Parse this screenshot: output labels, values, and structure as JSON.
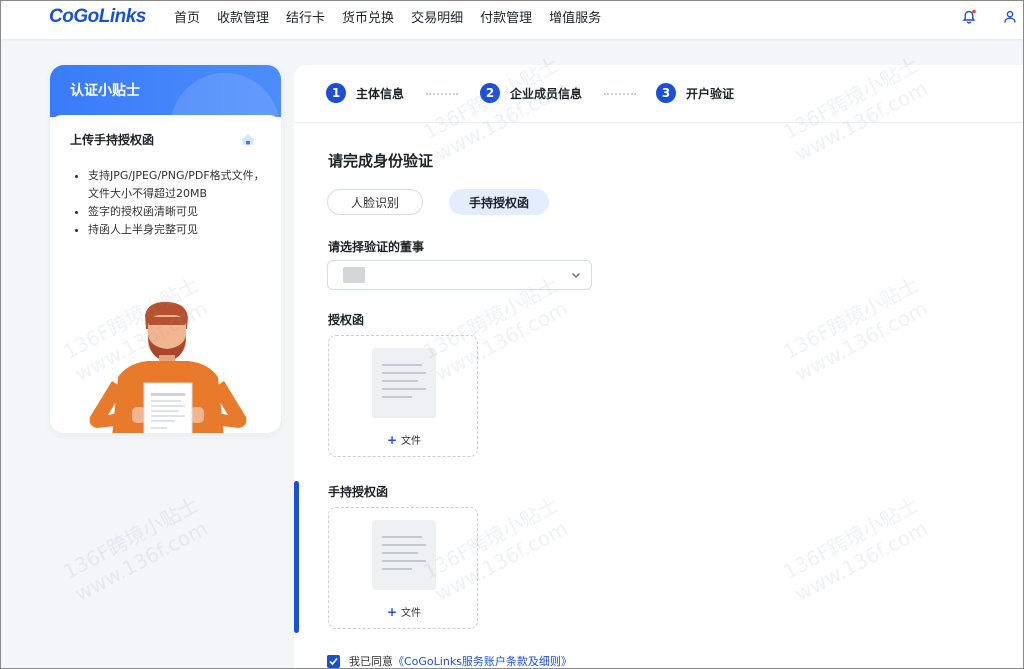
{
  "nav": {
    "logo": "CoGoLinks",
    "items": [
      "首页",
      "收款管理",
      "结行卡",
      "货币兑换",
      "交易明细",
      "付款管理",
      "增值服务"
    ]
  },
  "tip": {
    "title": "认证小贴士",
    "subtitle": "上传手持授权函",
    "items": [
      "支持JPG/JPEG/PNG/PDF格式文件， 文件大小不得超过20MB",
      "签字的授权函清晰可见",
      "持函人上半身完整可见"
    ]
  },
  "steps": [
    {
      "num": "1",
      "label": "主体信息"
    },
    {
      "num": "2",
      "label": "企业成员信息"
    },
    {
      "num": "3",
      "label": "开户验证"
    }
  ],
  "form": {
    "section_title": "请完成身份验证",
    "tabs": {
      "face": "人脸识别",
      "hand": "手持授权函"
    },
    "director_label": "请选择验证的董事",
    "auth_letter_label": "授权函",
    "hand_letter_label": "手持授权函",
    "upload_label": "文件",
    "agree_text": "我已同意",
    "agree_link": "《CoGoLinks服务账户条款及细则》"
  },
  "watermark": {
    "line1": "136F跨境小贴士",
    "line2": "www.136f.com"
  },
  "colors": {
    "primary": "#1b4fd6",
    "tab_active_bg": "#e4edfd",
    "tip_header": "#3a7bfa"
  }
}
